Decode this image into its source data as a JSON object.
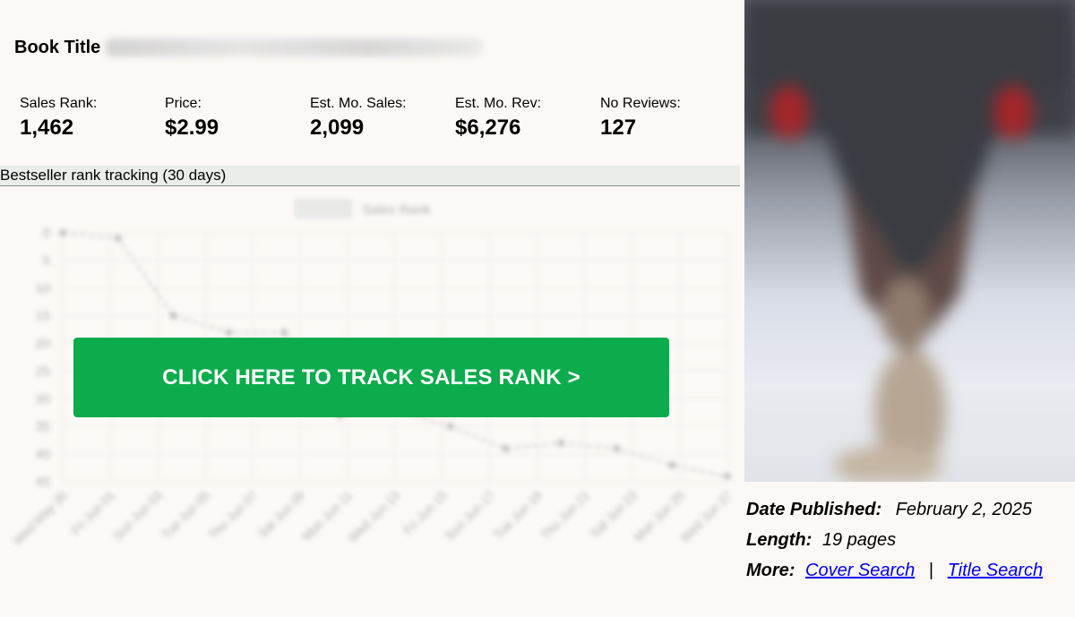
{
  "book": {
    "title_label": "Book Title"
  },
  "stats": [
    {
      "label": "Sales Rank:",
      "value": "1,462"
    },
    {
      "label": "Price:",
      "value": "$2.99"
    },
    {
      "label": "Est. Mo. Sales:",
      "value": "2,099"
    },
    {
      "label": "Est. Mo. Rev:",
      "value": "$6,276"
    },
    {
      "label": "No Reviews:",
      "value": "127"
    }
  ],
  "tracking": {
    "header": "Bestseller rank tracking (30 days)",
    "cta_label": "CLICK HERE TO TRACK SALES RANK >"
  },
  "chart_data": {
    "type": "line",
    "series": [
      {
        "name": "Sales Rank",
        "values": [
          0,
          1,
          15,
          18,
          18,
          33,
          32,
          35,
          39,
          38,
          39,
          42,
          44
        ]
      }
    ],
    "x": [
      "Wed May 30",
      "Fri Jun 01",
      "Sun Jun 03",
      "Tue Jun 05",
      "Thu Jun 07",
      "Sat Jun 09",
      "Mon Jun 11",
      "Wed Jun 13",
      "Fri Jun 15",
      "Sun Jun 17",
      "Tue Jun 19",
      "Thu Jun 21",
      "Sat Jun 23",
      "Mon Jun 25",
      "Wed Jun 27"
    ],
    "y_ticks": [
      0,
      5,
      10,
      15,
      20,
      25,
      30,
      35,
      40,
      45
    ],
    "ylim": [
      0,
      45
    ],
    "y_reversed": true,
    "grid": true,
    "legend_position": "top",
    "colors": {
      "line": "#bdbdbd",
      "point": "#b0b0b0",
      "grid": "#e3e3e3",
      "text": "#9a9a9a"
    }
  },
  "meta": {
    "date_label": "Date Published:",
    "date_value": "February 2, 2025",
    "length_label": "Length:",
    "length_value": "19 pages",
    "more_label": "More:",
    "cover_search": "Cover Search",
    "separator": "|",
    "title_search": "Title Search"
  },
  "colors": {
    "cta": "#0cab4c",
    "link": "#0000ee",
    "background": "#fcf8f5"
  }
}
